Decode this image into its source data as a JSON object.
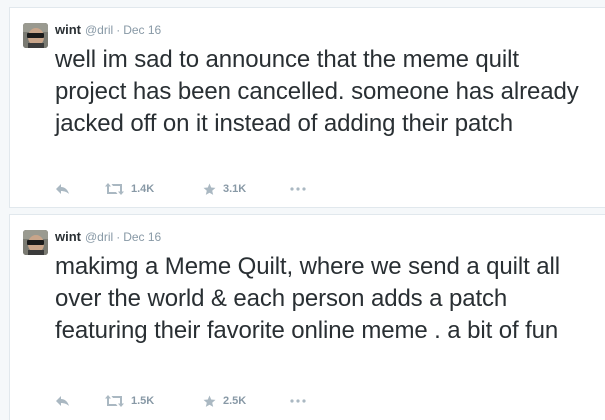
{
  "tweets": [
    {
      "author": {
        "name": "wint",
        "handle": "@dril",
        "separator": "·",
        "date": "Dec 16",
        "avatar_icon": "avatar-icon"
      },
      "text": "well im sad to announce that the meme quilt project has been cancelled. someone has already jacked off on it instead of adding their patch",
      "actions": {
        "reply_icon": "reply-icon",
        "retweet_icon": "retweet-icon",
        "retweets": "1.4K",
        "favorite_icon": "star-icon",
        "favorites": "3.1K",
        "more_icon": "more-dots-icon"
      }
    },
    {
      "author": {
        "name": "wint",
        "handle": "@dril",
        "separator": "·",
        "date": "Dec 16",
        "avatar_icon": "avatar-icon"
      },
      "text": "makimg a Meme Quilt, where we send a quilt all over the world & each person adds a patch featuring their favorite online meme . a bit of fun",
      "actions": {
        "reply_icon": "reply-icon",
        "retweet_icon": "retweet-icon",
        "retweets": "1.5K",
        "favorite_icon": "star-icon",
        "favorites": "2.5K",
        "more_icon": "more-dots-icon"
      }
    }
  ],
  "colors": {
    "page_bg": "#f5f8fa",
    "card_bg": "#ffffff",
    "border": "#e1e8ed",
    "text": "#292f33",
    "muted": "#8899a6",
    "icon": "#aab8c2"
  }
}
